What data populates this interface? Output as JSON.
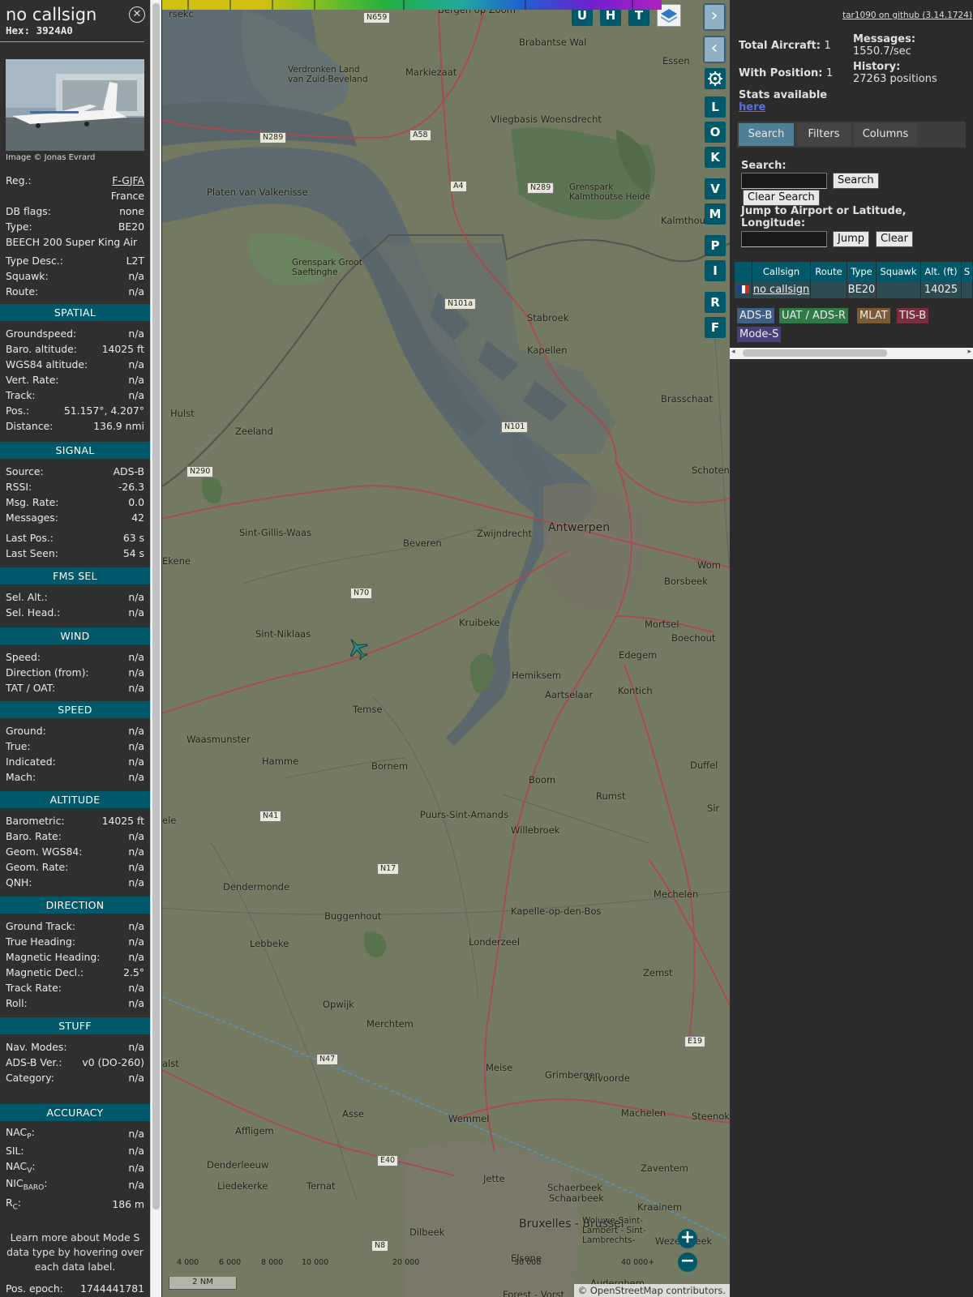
{
  "aircraft": {
    "callsign": "no callsign",
    "hex": "Hex: 3924A0",
    "close_icon": "close-icon",
    "photo_credit": "Image © Jonas Evrard"
  },
  "info": {
    "reg_label": "Reg.:",
    "reg": "F-GJFA",
    "country": "France",
    "dbflags_label": "DB flags:",
    "dbflags": "none",
    "type_label": "Type:",
    "type": "BE20",
    "type_full": "BEECH 200 Super King Air",
    "typedesc_label": "Type Desc.:",
    "typedesc": "L2T",
    "squawk_label": "Squawk:",
    "squawk": "n/a",
    "route_label": "Route:",
    "route": "n/a"
  },
  "sections": {
    "spatial": "SPATIAL",
    "signal": "SIGNAL",
    "fms": "FMS SEL",
    "wind": "WIND",
    "speed": "SPEED",
    "altitude": "ALTITUDE",
    "direction": "DIRECTION",
    "stuff": "STUFF",
    "accuracy": "ACCURACY"
  },
  "spatial": [
    [
      "Groundspeed:",
      "n/a"
    ],
    [
      "Baro. altitude:",
      "14025 ft"
    ],
    [
      "WGS84 altitude:",
      "n/a"
    ],
    [
      "Vert. Rate:",
      "n/a"
    ],
    [
      "Track:",
      "n/a"
    ],
    [
      "Pos.:",
      "51.157°, 4.207°"
    ],
    [
      "Distance:",
      "136.9 nmi"
    ]
  ],
  "signal": [
    [
      "Source:",
      "ADS-B"
    ],
    [
      "RSSI:",
      "-26.3"
    ],
    [
      "Msg. Rate:",
      "0.0"
    ],
    [
      "Messages:",
      "42"
    ],
    [
      "Last Pos.:",
      "63 s"
    ],
    [
      "Last Seen:",
      "54 s"
    ]
  ],
  "fms": [
    [
      "Sel. Alt.:",
      "n/a"
    ],
    [
      "Sel. Head.:",
      "n/a"
    ]
  ],
  "wind": [
    [
      "Speed:",
      "n/a"
    ],
    [
      "Direction (from):",
      "n/a"
    ],
    [
      "TAT / OAT:",
      "n/a"
    ]
  ],
  "speed": [
    [
      "Ground:",
      "n/a"
    ],
    [
      "True:",
      "n/a"
    ],
    [
      "Indicated:",
      "n/a"
    ],
    [
      "Mach:",
      "n/a"
    ]
  ],
  "altitude": [
    [
      "Barometric:",
      "14025 ft"
    ],
    [
      "Baro. Rate:",
      "n/a"
    ],
    [
      "Geom. WGS84:",
      "n/a"
    ],
    [
      "Geom. Rate:",
      "n/a"
    ],
    [
      "QNH:",
      "n/a"
    ]
  ],
  "direction": [
    [
      "Ground Track:",
      "n/a"
    ],
    [
      "True Heading:",
      "n/a"
    ],
    [
      "Magnetic Heading:",
      "n/a"
    ],
    [
      "Magnetic Decl.:",
      "2.5°"
    ],
    [
      "Track Rate:",
      "n/a"
    ],
    [
      "Roll:",
      "n/a"
    ]
  ],
  "stuff": [
    [
      "Nav. Modes:",
      "n/a"
    ],
    [
      "ADS-B Ver.:",
      "v0 (DO-260)"
    ],
    [
      "Category:",
      "n/a"
    ]
  ],
  "accuracy": {
    "nacp_base": "NAC",
    "nacp_sub": "P",
    "nacp": "n/a",
    "sil_label": "SIL:",
    "sil": "n/a",
    "nacv_base": "NAC",
    "nacv_sub": "V",
    "nacv": "n/a",
    "nicbaro_base": "NIC",
    "nicbaro_sub": "BARO",
    "nicbaro": "n/a",
    "rc_base": "R",
    "rc_sub": "C",
    "rc": "186 m",
    "colon": ":"
  },
  "sidebar_note": "Learn more about Mode S data type by hovering over each data label.",
  "pos_epoch_label": "Pos. epoch:",
  "pos_epoch": "1744441781",
  "map": {
    "buttons": {
      "u": "U",
      "h": "H",
      "t": "T",
      "l": "L",
      "o": "O",
      "k": "K",
      "v": "V",
      "m": "M",
      "p": "P",
      "i": "I",
      "r": "R",
      "f": "F"
    },
    "places": [
      "Bergen op Zoom",
      "Essen",
      "Brabantse Wal",
      "Markiezaat",
      "Verdronken Land van Zuid-Beveland",
      "Vliegbasis Woensdrecht",
      "Grenspark Kalmthoutse Heide",
      "Kalmthout",
      "Platen van Valkenisse",
      "Grenspark Groot Saeftinghe",
      "Stabroek",
      "Kapellen",
      "Hulst",
      "Brasschaat",
      "Zeeland",
      "Schoten",
      "Sint-Gillis-Waas",
      "Beveren",
      "Zwijndrecht",
      "Antwerpen",
      "Borsbeek",
      "Mortsel",
      "Boechout",
      "Sint-Niklaas",
      "Kruibeke",
      "Edegem",
      "Hemiksem",
      "Aartselaar",
      "Kontich",
      "Temse",
      "Waasmunster",
      "Hamme",
      "Bornem",
      "Boom",
      "Rumst",
      "Duffel",
      "Puurs-Sint-Amands",
      "Willebroek",
      "Dendermonde",
      "Buggenhout",
      "Kapelle-op-den-Bos",
      "Mechelen",
      "Lebbeke",
      "Londerzeel",
      "Zemst",
      "Opwijk",
      "Merchtem",
      "Meise",
      "Grimbergen",
      "Vilvoorde",
      "Asse",
      "Wemmel",
      "Machelen",
      "Steenokk",
      "Affligem",
      "Denderleeuw",
      "Zaventem",
      "Liedekerke",
      "Ternat",
      "Jette",
      "Schaerbeek",
      "Schaarbeek",
      "Kraainem",
      "Dilbeek",
      "Bruxelles - Brussel",
      "Woluwe-Saint-Lambert - Sint-Lambrechts-",
      "Wezembeek",
      "Auderghem",
      "Elsene",
      "Ekene",
      "Wom",
      "Sir",
      "alst",
      "ele",
      "rsekc",
      "Forest - Vorst"
    ],
    "roads": [
      "N659",
      "N289",
      "A58",
      "A4",
      "N289",
      "N101a",
      "N101",
      "N290",
      "N70",
      "N41",
      "N17",
      "N47",
      "E40",
      "N8",
      "E19"
    ],
    "colorbar_labels": [
      "4 000",
      "6 000",
      "8 000",
      "10 000",
      "20 000",
      "30 000",
      "40 000+"
    ],
    "scale": "2 NM",
    "attribution_prefix": "© ",
    "attribution_link": "OpenStreetMap",
    "attribution_suffix": " contributors.",
    "zoom_in": "+",
    "zoom_out": "−",
    "layers_icon": "layers-icon",
    "settings_icon": "gear-icon"
  },
  "right": {
    "github": "tar1090 on github (3.14.1724)",
    "total_label": "Total Aircraft:",
    "total": "1",
    "withpos_label": "With Position:",
    "withpos": "1",
    "stats_label": "Stats available",
    "stats_link": "here",
    "messages_label": "Messages:",
    "messages": "1550.7/sec",
    "history_label": "History:",
    "history": "27263 positions",
    "tabs": [
      "Search",
      "Filters",
      "Columns"
    ],
    "search_label": "Search:",
    "search_button": "Search",
    "clear_search": "Clear Search",
    "jump_label": "Jump to Airport or Latitude, Longitude:",
    "jump_button": "Jump",
    "clear_button": "Clear",
    "table_headers": [
      "",
      "Callsign",
      "Route",
      "Type",
      "Squawk",
      "Alt. (ft)",
      "S"
    ],
    "table_row": [
      "",
      "no callsign",
      "",
      "BE20",
      "",
      "14025",
      ""
    ],
    "sources": [
      "ADS-B",
      "UAT / ADS-R",
      "MLAT",
      "TIS-B",
      "Mode-S"
    ],
    "source_colors": [
      "#3f5f86",
      "#2f7a46",
      "#7a5a33",
      "#7a2f3f",
      "#4a3f7a"
    ]
  }
}
